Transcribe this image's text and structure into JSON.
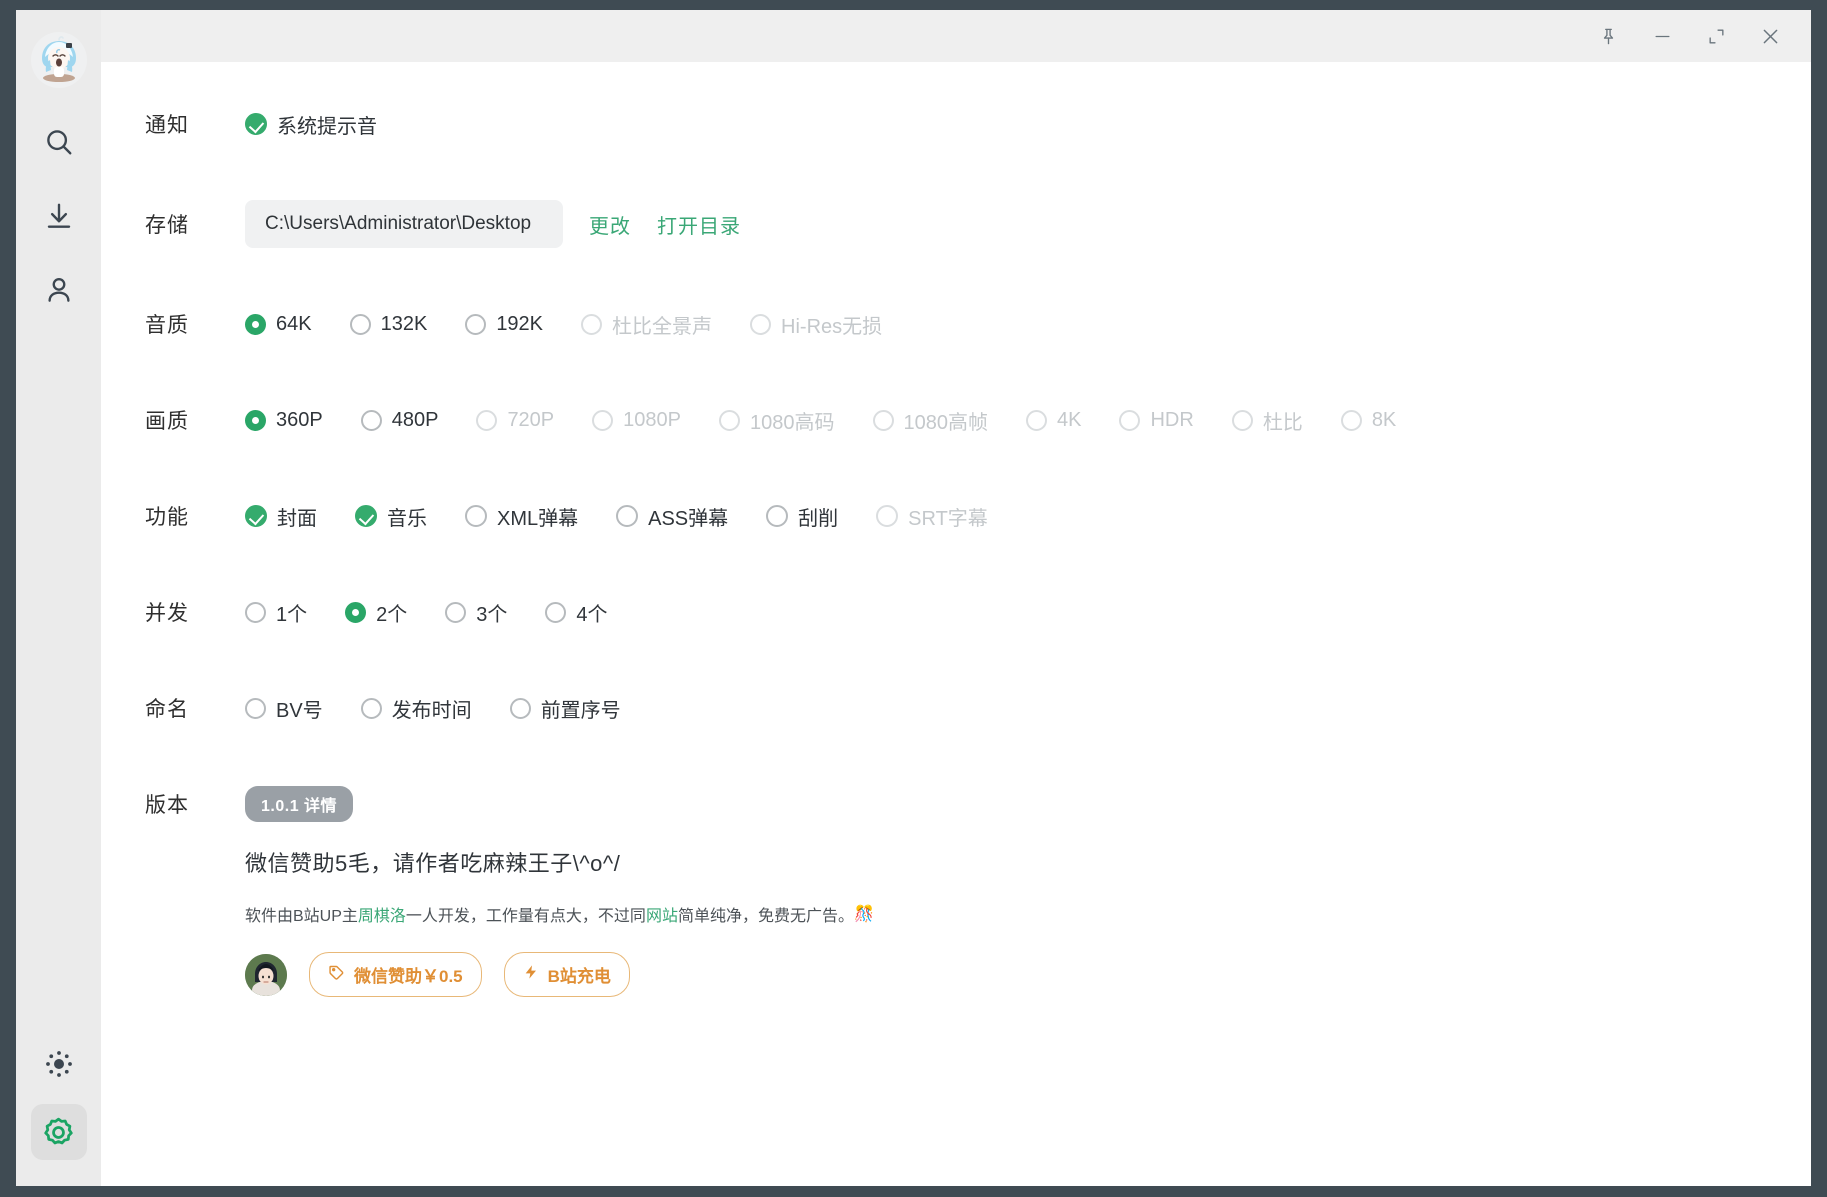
{
  "window": {
    "controls": [
      {
        "name": "pin-icon",
        "label": "固定"
      },
      {
        "name": "minimize-icon",
        "label": "最小化"
      },
      {
        "name": "maximize-icon",
        "label": "最大化"
      },
      {
        "name": "close-icon",
        "label": "关闭"
      }
    ]
  },
  "sidebar": {
    "avatar_alt": "用户头像",
    "items": [
      {
        "icon": "search-icon",
        "label": "搜索"
      },
      {
        "icon": "download-icon",
        "label": "下载"
      },
      {
        "icon": "user-icon",
        "label": "我的"
      }
    ],
    "bottom_items": [
      {
        "icon": "theme-icon",
        "label": "主题",
        "active": false
      },
      {
        "icon": "gear-icon",
        "label": "设置",
        "active": true
      }
    ]
  },
  "settings": {
    "notification": {
      "label": "通知",
      "options": [
        {
          "text": "系统提示音",
          "checked": true,
          "disabled": false
        }
      ]
    },
    "storage": {
      "label": "存储",
      "path": "C:\\Users\\Administrator\\Desktop",
      "change_label": "更改",
      "open_dir_label": "打开目录"
    },
    "audio_quality": {
      "label": "音质",
      "options": [
        {
          "text": "64K",
          "selected": true,
          "disabled": false
        },
        {
          "text": "132K",
          "selected": false,
          "disabled": false
        },
        {
          "text": "192K",
          "selected": false,
          "disabled": false
        },
        {
          "text": "杜比全景声",
          "selected": false,
          "disabled": true
        },
        {
          "text": "Hi-Res无损",
          "selected": false,
          "disabled": true
        }
      ]
    },
    "video_quality": {
      "label": "画质",
      "options": [
        {
          "text": "360P",
          "selected": true,
          "disabled": false
        },
        {
          "text": "480P",
          "selected": false,
          "disabled": false
        },
        {
          "text": "720P",
          "selected": false,
          "disabled": true
        },
        {
          "text": "1080P",
          "selected": false,
          "disabled": true
        },
        {
          "text": "1080高码",
          "selected": false,
          "disabled": true
        },
        {
          "text": "1080高帧",
          "selected": false,
          "disabled": true
        },
        {
          "text": "4K",
          "selected": false,
          "disabled": true
        },
        {
          "text": "HDR",
          "selected": false,
          "disabled": true
        },
        {
          "text": "杜比",
          "selected": false,
          "disabled": true
        },
        {
          "text": "8K",
          "selected": false,
          "disabled": true
        }
      ]
    },
    "features": {
      "label": "功能",
      "options": [
        {
          "text": "封面",
          "checked": true,
          "disabled": false
        },
        {
          "text": "音乐",
          "checked": true,
          "disabled": false
        },
        {
          "text": "XML弹幕",
          "checked": false,
          "disabled": false
        },
        {
          "text": "ASS弹幕",
          "checked": false,
          "disabled": false
        },
        {
          "text": "刮削",
          "checked": false,
          "disabled": false
        },
        {
          "text": "SRT字幕",
          "checked": false,
          "disabled": true
        }
      ]
    },
    "concurrency": {
      "label": "并发",
      "options": [
        {
          "text": "1个",
          "selected": false,
          "disabled": false
        },
        {
          "text": "2个",
          "selected": true,
          "disabled": false
        },
        {
          "text": "3个",
          "selected": false,
          "disabled": false
        },
        {
          "text": "4个",
          "selected": false,
          "disabled": false
        }
      ]
    },
    "naming": {
      "label": "命名",
      "options": [
        {
          "text": "BV号",
          "selected": false,
          "disabled": false
        },
        {
          "text": "发布时间",
          "selected": false,
          "disabled": false
        },
        {
          "text": "前置序号",
          "selected": false,
          "disabled": false
        }
      ]
    },
    "version": {
      "label": "版本",
      "badge": "1.0.1 详情"
    }
  },
  "sponsor": {
    "title": "微信赞助5毛，请作者吃麻辣王子\\^o^/",
    "desc_part1": "软件由B站UP主 ",
    "desc_link1": "周棋洛",
    "desc_part2": " 一人开发，工作量有点大，不过同 ",
    "desc_link2": "网站",
    "desc_part3": " 简单纯净，免费无广告。",
    "desc_emoji": "🎊",
    "wechat_button": "微信赞助￥0.5",
    "bilibili_button": "B站充电"
  },
  "colors": {
    "accent_green": "#2aa667",
    "link_green": "#3aa776",
    "orange": "#e08f35",
    "window_border": "#3f4b53",
    "sidebar_bg": "#ebebeb"
  }
}
